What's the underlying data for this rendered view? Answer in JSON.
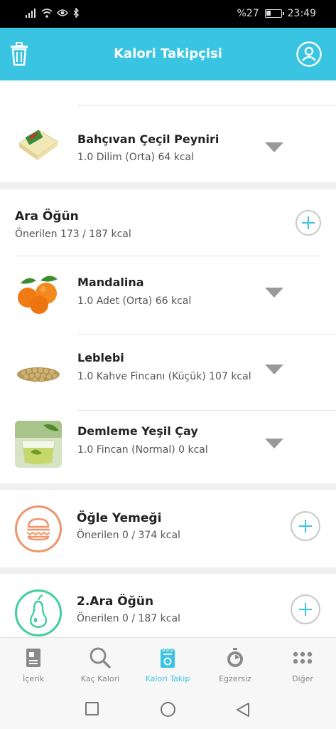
{
  "status_bar": {
    "battery_percent": "%27",
    "time": "23:49"
  },
  "header": {
    "title": "Kalori Takipçisi"
  },
  "breakfast_items": [
    {
      "name": "Bahçıvan Çeçil Peyniri",
      "detail": "1.0 Dilim (Orta) 64 kcal",
      "icon": "cheese-image"
    }
  ],
  "snack": {
    "title": "Ara Öğün",
    "subtitle": "Önerilen 173 / 187 kcal",
    "items": [
      {
        "name": "Mandalina",
        "detail": "1.0 Adet (Orta) 66 kcal",
        "icon": "tangerine-image"
      },
      {
        "name": "Leblebi",
        "detail": "1.0 Kahve Fincanı (Küçük) 107 kcal",
        "icon": "chickpea-image"
      },
      {
        "name": "Demleme Yeşil Çay",
        "detail": "1.0 Fincan (Normal) 0 kcal",
        "icon": "green-tea-image"
      }
    ]
  },
  "lunch": {
    "title": "Öğle Yemeği",
    "subtitle": "Önerilen 0 / 374 kcal",
    "icon": "burger-icon",
    "color": "#f0956a"
  },
  "snack2": {
    "title": "2.Ara Öğün",
    "subtitle": "Önerilen 0 / 187 kcal",
    "icon": "pear-icon",
    "color": "#3fcf9b"
  },
  "bottom_nav": [
    {
      "label": "İçerik",
      "icon": "book-icon",
      "active": false
    },
    {
      "label": "Kaç Kalori",
      "icon": "search-icon",
      "active": false
    },
    {
      "label": "Kalori Takip",
      "icon": "notepad-icon",
      "active": true
    },
    {
      "label": "Egzersiz",
      "icon": "stopwatch-icon",
      "active": false
    },
    {
      "label": "Diğer",
      "icon": "more-dots-icon",
      "active": false
    }
  ],
  "colors": {
    "accent": "#39c4e1",
    "lunch_ring": "#f0956a",
    "snack2_ring": "#3fcf9b"
  }
}
